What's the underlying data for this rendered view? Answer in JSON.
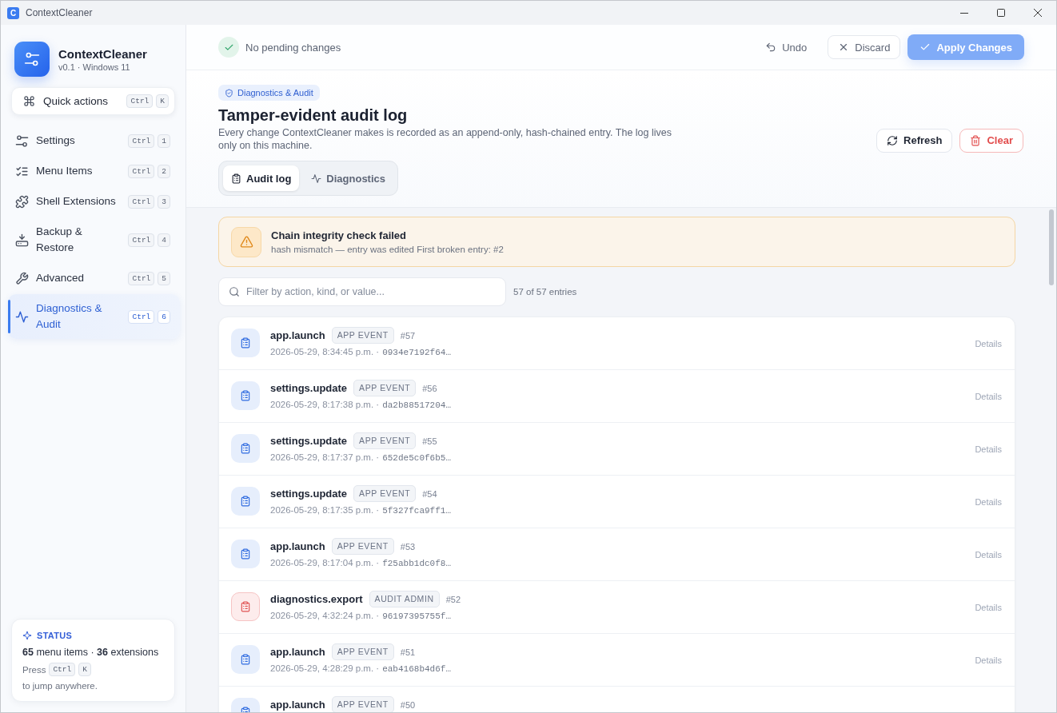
{
  "window": {
    "title": "ContextCleaner",
    "app_icon_letter": "C"
  },
  "sidebar": {
    "app_name": "ContextCleaner",
    "version": "v0.1 · Windows 11",
    "quick_actions": {
      "label": "Quick actions",
      "keys": [
        "Ctrl",
        "K"
      ]
    },
    "items": [
      {
        "label": "Settings",
        "keys": [
          "Ctrl",
          "1"
        ],
        "selected": false
      },
      {
        "label": "Menu Items",
        "keys": [
          "Ctrl",
          "2"
        ],
        "selected": false
      },
      {
        "label": "Shell Extensions",
        "keys": [
          "Ctrl",
          "3"
        ],
        "selected": false
      },
      {
        "label": "Backup & Restore",
        "keys": [
          "Ctrl",
          "4"
        ],
        "selected": false
      },
      {
        "label": "Advanced",
        "keys": [
          "Ctrl",
          "5"
        ],
        "selected": false
      },
      {
        "label": "Diagnostics & Audit",
        "keys": [
          "Ctrl",
          "6"
        ],
        "selected": true
      }
    ],
    "status": {
      "label": "STATUS",
      "summary": "**65** menu items · **36** extensions",
      "hint_prefix": "Press",
      "hint_keys": [
        "Ctrl",
        "K"
      ],
      "hint_suffix": "to jump anywhere."
    }
  },
  "toolbar": {
    "status": "No pending changes",
    "buttons": [
      {
        "label": "Undo",
        "kind": "ghost",
        "disabled": true
      },
      {
        "label": "Discard",
        "kind": "outline",
        "disabled": true
      },
      {
        "label": "Apply Changes",
        "kind": "primary",
        "disabled": true
      }
    ]
  },
  "page": {
    "badge": "Diagnostics & Audit",
    "title": "Tamper-evident audit log",
    "description": "Every change ContextCleaner makes is recorded as an append-only, hash-chained entry. The log lives only on this machine.",
    "actions": [
      {
        "label": "Refresh",
        "kind": "default"
      },
      {
        "label": "Clear",
        "kind": "danger"
      }
    ],
    "tabs": [
      {
        "label": "Audit log",
        "selected": true
      },
      {
        "label": "Diagnostics",
        "selected": false
      }
    ]
  },
  "alert": {
    "title": "Chain integrity check failed",
    "message": "hash mismatch — entry was edited First broken entry: #2"
  },
  "filter": {
    "placeholder": "Filter by action, kind, or value...",
    "count": "57 of 57 entries"
  },
  "entries": [
    {
      "kind": "event",
      "action": "app.launch",
      "category": "APP EVENT",
      "number": "#57",
      "time": "2026-05-29, 8:34:45 p.m. ·",
      "hash": "0934e7192f64…",
      "link": "Details"
    },
    {
      "kind": "event",
      "action": "settings.update",
      "category": "APP EVENT",
      "number": "#56",
      "time": "2026-05-29, 8:17:38 p.m. ·",
      "hash": "da2b88517204…",
      "link": "Details"
    },
    {
      "kind": "event",
      "action": "settings.update",
      "category": "APP EVENT",
      "number": "#55",
      "time": "2026-05-29, 8:17:37 p.m. ·",
      "hash": "652de5c0f6b5…",
      "link": "Details"
    },
    {
      "kind": "event",
      "action": "settings.update",
      "category": "APP EVENT",
      "number": "#54",
      "time": "2026-05-29, 8:17:35 p.m. ·",
      "hash": "5f327fca9ff1…",
      "link": "Details"
    },
    {
      "kind": "event",
      "action": "app.launch",
      "category": "APP EVENT",
      "number": "#53",
      "time": "2026-05-29, 8:17:04 p.m. ·",
      "hash": "f25abb1dc0f8…",
      "link": "Details"
    },
    {
      "kind": "admin",
      "action": "diagnostics.export",
      "category": "AUDIT ADMIN",
      "number": "#52",
      "time": "2026-05-29, 4:32:24 p.m. ·",
      "hash": "96197395755f…",
      "link": "Details"
    },
    {
      "kind": "event",
      "action": "app.launch",
      "category": "APP EVENT",
      "number": "#51",
      "time": "2026-05-29, 4:28:29 p.m. ·",
      "hash": "eab4168b4d6f…",
      "link": "Details"
    },
    {
      "kind": "event",
      "action": "app.launch",
      "category": "APP EVENT",
      "number": "#50"
    }
  ]
}
